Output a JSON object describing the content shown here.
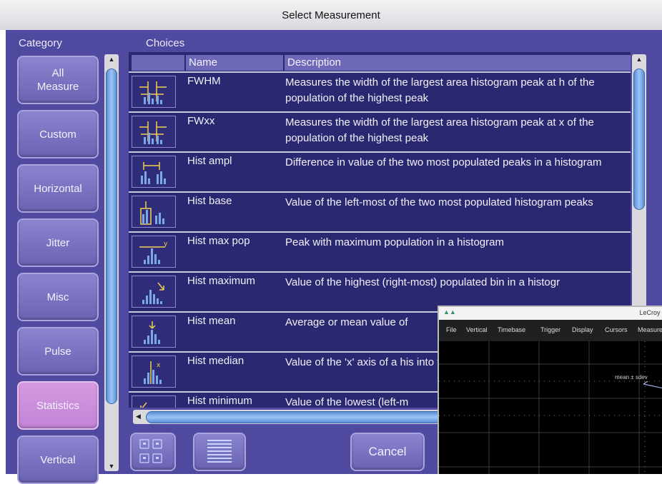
{
  "window": {
    "title": "Select Measurement"
  },
  "category": {
    "label": "Category",
    "items": [
      {
        "label": "All\nMeasure",
        "active": false
      },
      {
        "label": "Custom",
        "active": false
      },
      {
        "label": "Horizontal",
        "active": false
      },
      {
        "label": "Jitter",
        "active": false
      },
      {
        "label": "Misc",
        "active": false
      },
      {
        "label": "Pulse",
        "active": false
      },
      {
        "label": "Statistics",
        "active": true
      },
      {
        "label": "Vertical",
        "active": false
      }
    ]
  },
  "choices": {
    "label": "Choices",
    "columns": {
      "name": "Name",
      "description": "Description"
    },
    "rows": [
      {
        "name": "FWHM",
        "description": "Measures the width of the largest area histogram peak at h of the population of the highest peak",
        "icon": "fwhm-icon"
      },
      {
        "name": "FWxx",
        "description": "Measures the width of the largest area histogram peak at x of the population of the highest peak",
        "icon": "fwxx-icon"
      },
      {
        "name": "Hist ampl",
        "description": "Difference in value of the two most populated peaks in a histogram",
        "icon": "hist-ampl-icon"
      },
      {
        "name": "Hist base",
        "description": "Value of the left-most of the two most populated histogram peaks",
        "icon": "hist-base-icon"
      },
      {
        "name": "Hist max pop",
        "description": "Peak with maximum population in a histogram",
        "icon": "hist-max-pop-icon"
      },
      {
        "name": "Hist maximum",
        "description": "Value of the highest (right-most) populated bin in a histogr",
        "icon": "hist-maximum-icon"
      },
      {
        "name": "Hist mean",
        "description": "Average or mean value of",
        "icon": "hist-mean-icon"
      },
      {
        "name": "Hist median",
        "description": "Value of the 'x' axis of a his into two equal halves",
        "icon": "hist-median-icon"
      },
      {
        "name": "Hist minimum",
        "description": "Value of the lowest (left-m",
        "icon": "hist-minimum-icon"
      }
    ]
  },
  "buttons": {
    "cancel": "Cancel"
  },
  "scope": {
    "brand": "LeCroy V",
    "menu": [
      "File",
      "Vertical",
      "Timebase",
      "Trigger",
      "Display",
      "Cursors",
      "Measure"
    ],
    "annotation": "mean ± sdev"
  },
  "colors": {
    "dialog_bg": "#4f4aa0",
    "table_bg": "#2b2872",
    "active_category": "#c183d6",
    "scrollbar_thumb": "#7fb0ee"
  }
}
